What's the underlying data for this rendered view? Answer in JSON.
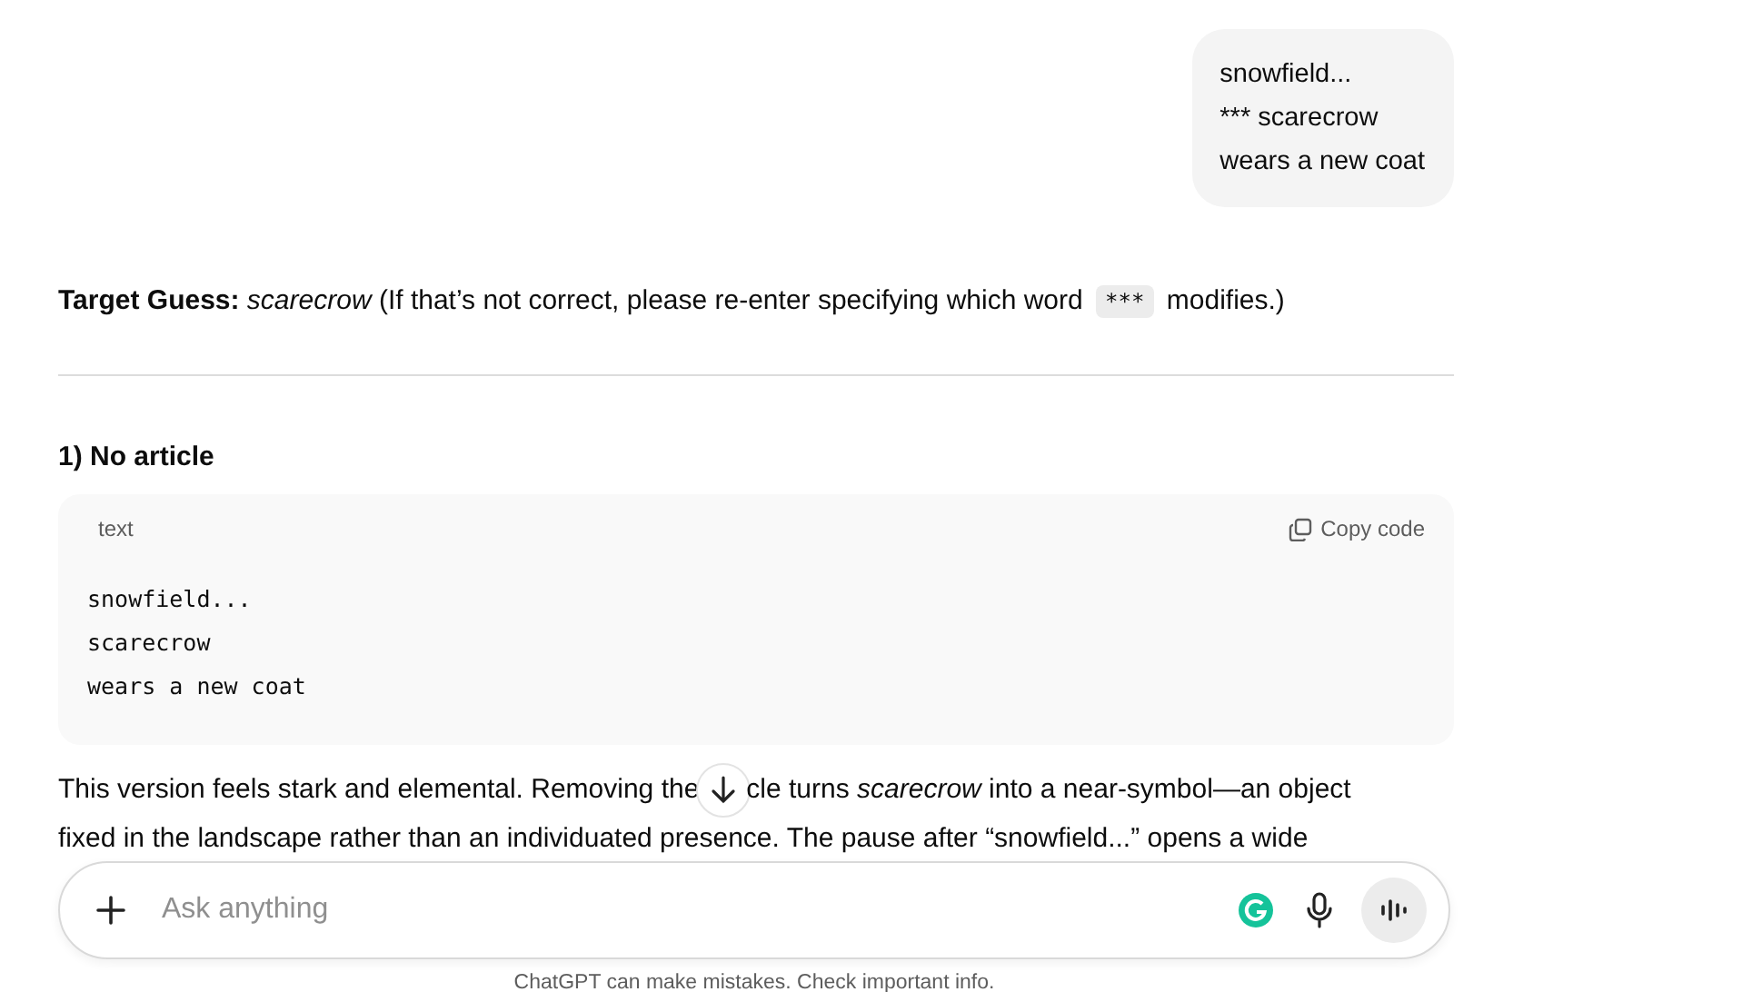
{
  "user_message": {
    "lines": [
      "snowfield...",
      "*** scarecrow",
      "wears a new coat"
    ]
  },
  "target_guess": {
    "before": "**Target Guess:** *scarecrow* (If that’s not correct, please re-enter specifying which word",
    "code": "***",
    "after": "modifies.)"
  },
  "heading": "1) No article",
  "code_block": {
    "language": "text",
    "copy_label": "Copy code",
    "lines": [
      "snowfield...",
      "scarecrow",
      "wears a new coat"
    ]
  },
  "paragraph": {
    "line_1_start": "This version feels stark and elemental. Removing the",
    "line_1_end": "cle turns *scarecrow* into a near-symbol—an object",
    "line_2": "fixed in the landscape rather than an individuated presence. The pause after “snowfield...” opens a wide"
  },
  "composer": {
    "placeholder": "Ask anything"
  },
  "footer": "ChatGPT can make mistakes. Check important info."
}
